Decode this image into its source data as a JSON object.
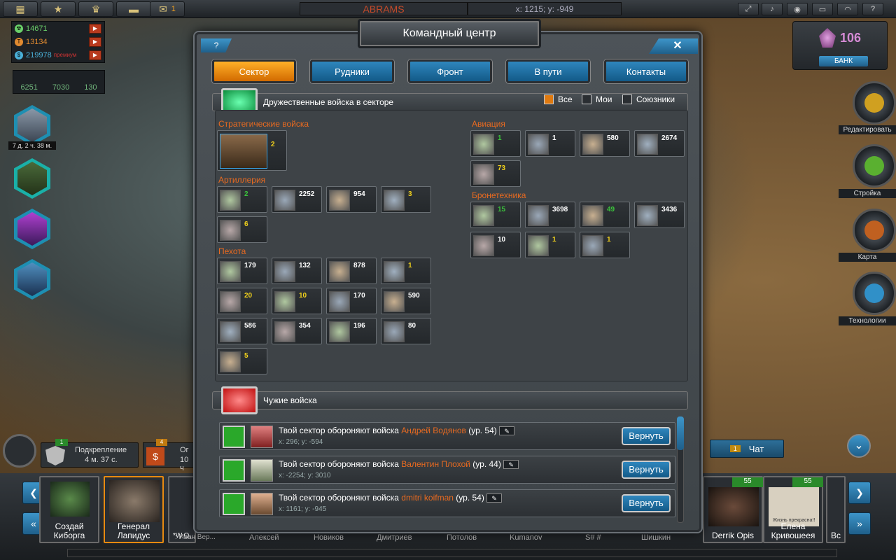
{
  "topbar": {
    "mail_count": "1",
    "nickname": "ABRAMS",
    "coords": "x: 1215; y: -949",
    "sys_icons": [
      "fullscreen-icon",
      "sound-icon",
      "eye-icon",
      "flag-icon",
      "signal-icon",
      "help-icon"
    ]
  },
  "resources": {
    "r1": "14671",
    "r2": "13134",
    "r3": "219978",
    "r3_suffix": "премиум",
    "units": [
      "6251",
      "7030",
      "130"
    ]
  },
  "left": {
    "timer": "7 д. 2 ч. 38 м."
  },
  "crystal": {
    "value": "106",
    "bank": "БАНК"
  },
  "right_menu": [
    "Редактировать",
    "Стройка",
    "Карта",
    "Технологии"
  ],
  "bottom": {
    "reinforce_count": "1",
    "reinforce_label": "Подкрепление",
    "reinforce_time": "4 м. 37 с.",
    "next_count": "4",
    "next_label": "Ог",
    "next_time": "10 ч",
    "chat_count": "1",
    "chat_label": "Чат",
    "create_cyborg": "Создай Киборга",
    "general": "Генерал Лапидус",
    "derrik": "Derrik Opis",
    "elena": "Елена Кривошеея",
    "elena_lvl": "55",
    "derrik_lvl": "55",
    "partial_names": [
      "*W.O.",
      ": Иван Вер...",
      "Алексей",
      "Новиков",
      "Дмитриев",
      "Потолов",
      "Kumanov",
      "S# #",
      "Шишкин",
      "Вс"
    ],
    "elena_caption": "Жизнь прекрасна!!"
  },
  "modal": {
    "title": "Командный центр",
    "help": "?",
    "close": "✕",
    "tabs": [
      "Сектор",
      "Рудники",
      "Фронт",
      "В пути",
      "Контакты"
    ],
    "friendly_header": "Дружественные войска в секторе",
    "filters": [
      "Все",
      "Мои",
      "Союзники"
    ],
    "foreign_header": "Чужие войска",
    "categories": {
      "strategic": "Стратегические войска",
      "artillery": "Артиллерия",
      "infantry": "Пехота",
      "aviation": "Авиация",
      "armor": "Бронетехника"
    },
    "strategic": [
      "2"
    ],
    "artillery": [
      "2",
      "2252",
      "954",
      "3",
      "6"
    ],
    "infantry": [
      "179",
      "132",
      "878",
      "1",
      "20",
      "10",
      "170",
      "590",
      "586",
      "354",
      "196",
      "80",
      "5"
    ],
    "aviation": [
      "1",
      "1",
      "580",
      "2674",
      "73"
    ],
    "armor": [
      "15",
      "3698",
      "49",
      "3436",
      "10",
      "1",
      "1"
    ],
    "foreign": [
      {
        "prefix": "Твой сектор обороняют войска",
        "name": "Андрей Водянов",
        "level": "(ур. 54)",
        "coords": "x: 296; y: -594",
        "button": "Вернуть"
      },
      {
        "prefix": "Твой сектор обороняют войска",
        "name": "Валентин Плохой",
        "level": "(ур. 44)",
        "coords": "x: -2254; y: 3010",
        "button": "Вернуть"
      },
      {
        "prefix": "Твой сектор обороняют войска",
        "name": "dmitri koifman",
        "level": "(ур. 54)",
        "coords": "x: 1161; y: -945",
        "button": "Вернуть"
      }
    ]
  }
}
